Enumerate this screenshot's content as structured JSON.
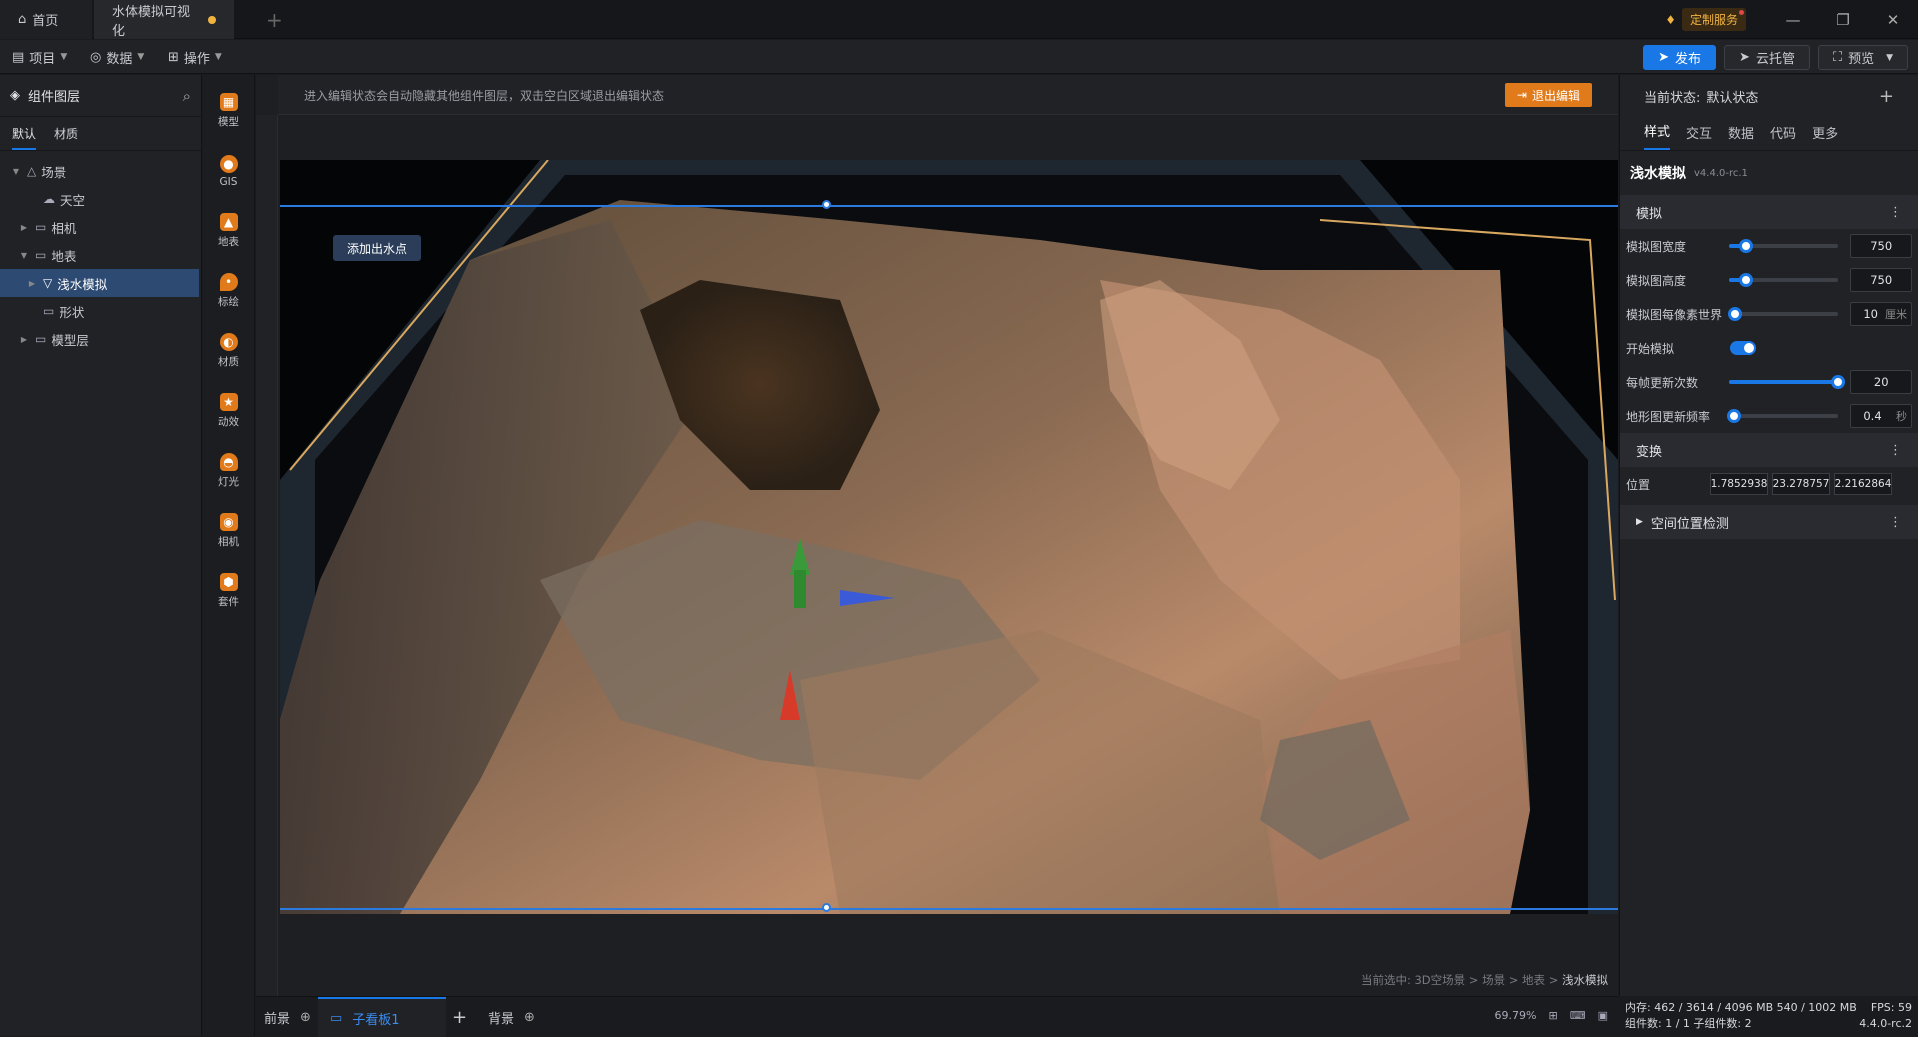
{
  "titlebar": {
    "home": "首页",
    "doc": "水体模拟可视化",
    "custom": "定制服务"
  },
  "menu": {
    "project": "项目",
    "data": "数据",
    "ops": "操作"
  },
  "topbtns": {
    "publish": "发布",
    "cloud": "云托管",
    "preview": "预览"
  },
  "left": {
    "title": "组件图层",
    "tabs": [
      "默认",
      "材质"
    ],
    "tree": [
      {
        "label": "场景",
        "icon": "scene-icon"
      },
      {
        "label": "天空",
        "icon": "cloud-icon"
      },
      {
        "label": "相机",
        "icon": "folder-icon"
      },
      {
        "label": "地表",
        "icon": "folder-icon"
      },
      {
        "label": "浅水模拟",
        "icon": "filter-icon"
      },
      {
        "label": "形状",
        "icon": "folder-icon"
      },
      {
        "label": "模型层",
        "icon": "folder-icon"
      }
    ]
  },
  "iconbar": [
    "模型",
    "GIS",
    "地表",
    "标绘",
    "材质",
    "动效",
    "灯光",
    "相机",
    "套件"
  ],
  "canvas": {
    "hint": "进入编辑状态会自动隐藏其他组件图层，双击空白区域退出编辑状态",
    "exit": "退出编辑",
    "add_point": "添加出水点",
    "crumb_prefix": "当前选中: 3D空场景 > 场景 > 地表 > ",
    "crumb_current": "浅水模拟"
  },
  "bottom": {
    "front": "前景",
    "sub": "子看板1",
    "back": "背景",
    "zoom": "69.79%"
  },
  "right": {
    "state_label": "当前状态:",
    "state_value": "默认状态",
    "tabs": [
      "样式",
      "交互",
      "数据",
      "代码",
      "更多"
    ],
    "comp_name": "浅水模拟",
    "comp_ver": "v4.4.0-rc.1",
    "sec_sim": "模拟",
    "sec_tf": "变换",
    "sec_space": "空间位置检测",
    "rows": [
      {
        "label": "模拟图宽度",
        "value": "750",
        "unit": "",
        "level": 0.15
      },
      {
        "label": "模拟图高度",
        "value": "750",
        "unit": "",
        "level": 0.15
      },
      {
        "label": "模拟图每像素世界",
        "value": "10",
        "unit": "厘米",
        "level": 0.05
      },
      {
        "label": "每帧更新次数",
        "value": "20",
        "unit": "",
        "level": 1.0
      },
      {
        "label": "地形图更新频率",
        "value": "0.4",
        "unit": "秒",
        "level": 0.04
      }
    ],
    "toggle_label": "开始模拟",
    "pos_label": "位置",
    "pos": [
      "1.7852938",
      "23.278757",
      "2.2162864"
    ]
  },
  "status": {
    "line1": "内存:  462 / 3614 / 4096 MB  540 / 1002 MB",
    "fps": "FPS:  59",
    "line2": "组件数: 1 / 1   子组件数: 2",
    "ver": "4.4.0-rc.2"
  }
}
